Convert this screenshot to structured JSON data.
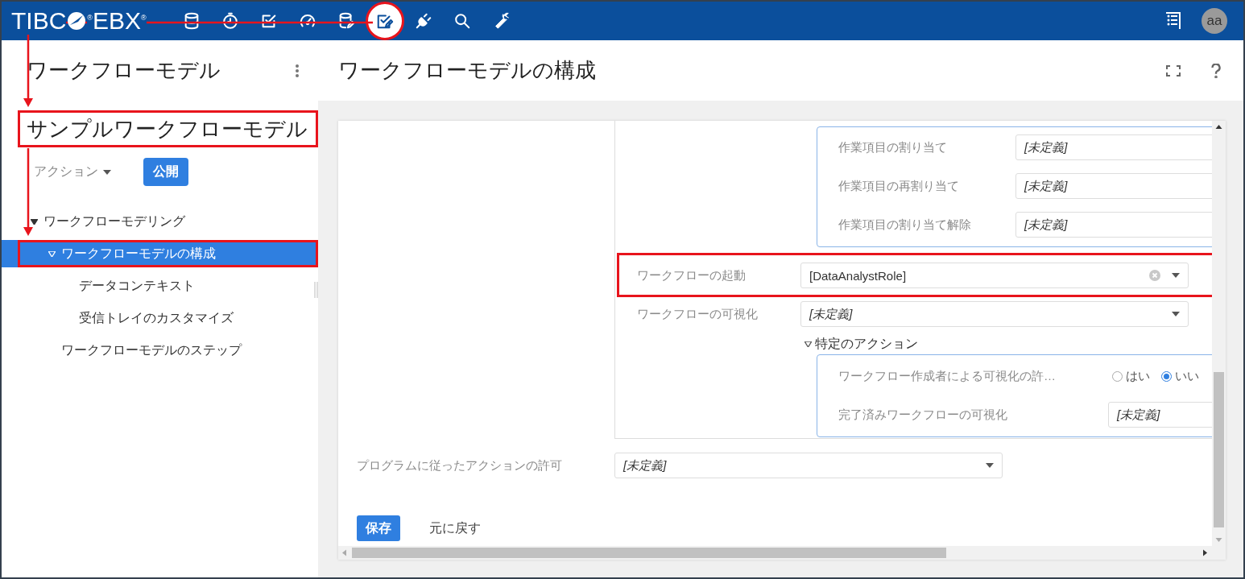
{
  "top_bar": {
    "logo": {
      "left": "TIBC",
      "right": "$^{®}$EBX$^{®}$"
    },
    "nav_icons": [
      {
        "kind": "database",
        "selected": false,
        "highlighted": false
      },
      {
        "kind": "clock",
        "selected": false,
        "highlighted": false
      },
      {
        "kind": "checklist",
        "selected": false,
        "highlighted": false
      },
      {
        "kind": "gauge",
        "selected": false,
        "highlighted": false
      },
      {
        "kind": "database-edit",
        "selected": false,
        "highlighted": false
      },
      {
        "kind": "checklist-edit",
        "selected": true,
        "highlighted": true
      },
      {
        "kind": "plug",
        "selected": false,
        "highlighted": false
      },
      {
        "kind": "search",
        "selected": false,
        "highlighted": false
      },
      {
        "kind": "wrench",
        "selected": false,
        "highlighted": false
      }
    ],
    "avatar": "aa"
  },
  "sidebar": {
    "title": "ワークフローモデル",
    "model_title": {
      "text": "サンプルワークフローモデル",
      "highlighted": true
    },
    "actions_menu": "アクション",
    "publish_button": "公開",
    "tree": [
      {
        "label": "ワークフローモデリング",
        "expanded": true,
        "selected": false,
        "highlighted": false,
        "children": [
          {
            "label": "ワークフローモデルの構成",
            "expanded": true,
            "selected": true,
            "highlighted": true,
            "children": [
              {
                "label": "データコンテキスト",
                "selected": false,
                "highlighted": false
              },
              {
                "label": "受信トレイのカスタマイズ",
                "selected": false,
                "highlighted": false
              }
            ]
          },
          {
            "label": "ワークフローモデルのステップ",
            "selected": false,
            "highlighted": false
          }
        ]
      }
    ]
  },
  "main": {
    "title": "ワークフローモデルの構成",
    "form": {
      "group": {
        "top_actions": [
          {
            "label": "作業項目の割り当て",
            "value": "[未定義]",
            "unset": true
          },
          {
            "label": "作業項目の再割り当て",
            "value": "[未定義]",
            "unset": true
          },
          {
            "label": "作業項目の割り当て解除",
            "value": "[未定義]",
            "unset": true
          }
        ],
        "fields": [
          {
            "label": "ワークフローの起動",
            "value": "[DataAnalystRole]",
            "unset": false,
            "clearable": true,
            "highlighted": true
          },
          {
            "label": "ワークフローの可視化",
            "value": "[未定義]",
            "unset": true,
            "clearable": false,
            "highlighted": false
          }
        ],
        "sub_section": {
          "title": "特定のアクション",
          "expanded": true,
          "rows": [
            {
              "kind": "radio",
              "label": "ワークフロー作成者による可視化の許…",
              "options": [
                {
                  "label": "はい",
                  "selected": false
                },
                {
                  "label": "いい",
                  "selected": true
                }
              ]
            },
            {
              "kind": "select",
              "label": "完了済みワークフローの可視化",
              "value": "[未定義]",
              "unset": true
            }
          ]
        }
      },
      "fields": [
        {
          "label": "プログラムに従ったアクションの許可",
          "value": "[未定義]",
          "unset": true,
          "clearable": false,
          "highlighted": false
        }
      ],
      "buttons": [
        {
          "kind": "primary",
          "label": "保存"
        },
        {
          "kind": "link",
          "label": "元に戻す"
        }
      ]
    }
  }
}
